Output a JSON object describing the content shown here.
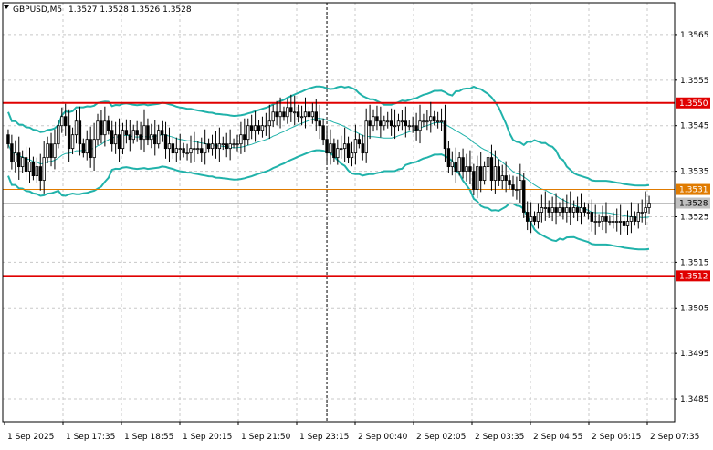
{
  "header": {
    "symbol_timeframe": "GBPUSD,M5",
    "ohlc": "1.3527 1.3528 1.3526 1.3528"
  },
  "chart_data": {
    "type": "candlestick",
    "symbol": "GBPUSD",
    "timeframe": "M5",
    "grid": true,
    "y_range": [
      1.348,
      1.3572
    ],
    "y_ticks": [
      "1.3565",
      "1.3555",
      "1.3545",
      "1.3535",
      "1.3525",
      "1.3515",
      "1.3505",
      "1.3495",
      "1.3485"
    ],
    "x_ticks": [
      "1 Sep 2025",
      "1 Sep 17:35",
      "1 Sep 18:55",
      "1 Sep 20:15",
      "1 Sep 21:50",
      "1 Sep 23:15",
      "2 Sep 00:40",
      "2 Sep 02:05",
      "2 Sep 03:35",
      "2 Sep 04:55",
      "2 Sep 06:15",
      "2 Sep 07:35"
    ],
    "horizontal_levels": [
      {
        "value": 1.355,
        "label": "1.3550",
        "color": "#e00000"
      },
      {
        "value": 1.3531,
        "label": "1.3531",
        "color": "#e07b00"
      },
      {
        "value": 1.3512,
        "label": "1.3512",
        "color": "#e00000"
      },
      {
        "value": 1.3528,
        "label": "1.3528",
        "color": "#c0c0c0",
        "current": true
      }
    ],
    "vertical_marker_index": 89,
    "candles_close": [
      1.3541,
      1.3537,
      1.3539,
      1.3536,
      1.3538,
      1.3535,
      1.3537,
      1.3534,
      1.3536,
      1.3533,
      1.3538,
      1.3541,
      1.3538,
      1.3541,
      1.3545,
      1.3547,
      1.3545,
      1.354,
      1.3543,
      1.3546,
      1.3541,
      1.3539,
      1.3542,
      1.3538,
      1.3542,
      1.3546,
      1.3543,
      1.3546,
      1.3544,
      1.3541,
      1.3543,
      1.354,
      1.3544,
      1.3543,
      1.3542,
      1.3544,
      1.3543,
      1.3542,
      1.3545,
      1.3542,
      1.3543,
      1.3541,
      1.3544,
      1.3543,
      1.354,
      1.3541,
      1.3539,
      1.354,
      1.354,
      1.3539,
      1.3539,
      1.354,
      1.354,
      1.354,
      1.3539,
      1.3541,
      1.354,
      1.3541,
      1.354,
      1.3541,
      1.3541,
      1.354,
      1.3541,
      1.3541,
      1.3541,
      1.3543,
      1.3542,
      1.3545,
      1.3544,
      1.3545,
      1.3544,
      1.3545,
      1.3545,
      1.3546,
      1.3548,
      1.3547,
      1.3548,
      1.3547,
      1.3549,
      1.3548,
      1.3548,
      1.3547,
      1.3547,
      1.3548,
      1.3547,
      1.3548,
      1.3546,
      1.3545,
      1.3542,
      1.3539,
      1.3541,
      1.3538,
      1.354,
      1.354,
      1.3541,
      1.3538,
      1.3539,
      1.3542,
      1.3541,
      1.3539,
      1.3546,
      1.3545,
      1.3547,
      1.3546,
      1.3545,
      1.3546,
      1.3546,
      1.3545,
      1.3545,
      1.3546,
      1.3546,
      1.3545,
      1.3545,
      1.3545,
      1.3544,
      1.3546,
      1.3546,
      1.3546,
      1.3547,
      1.3546,
      1.3546,
      1.3546,
      1.354,
      1.3536,
      1.3537,
      1.3535,
      1.3538,
      1.3535,
      1.3536,
      1.3535,
      1.3531,
      1.3536,
      1.3533,
      1.3536,
      1.3538,
      1.3533,
      1.3536,
      1.3533,
      1.3534,
      1.3533,
      1.3532,
      1.3531,
      1.3531,
      1.3533,
      1.3526,
      1.3524,
      1.3525,
      1.3524,
      1.3526,
      1.3527,
      1.3527,
      1.3526,
      1.3527,
      1.3526,
      1.3527,
      1.3526,
      1.3527,
      1.3526,
      1.3527,
      1.3526,
      1.3527,
      1.3526,
      1.3526,
      1.3524,
      1.3524,
      1.3524,
      1.3525,
      1.3524,
      1.3524,
      1.3524,
      1.3524,
      1.3524,
      1.3523,
      1.3524,
      1.3525,
      1.3524,
      1.3526,
      1.3526,
      1.3527,
      1.3528
    ]
  }
}
